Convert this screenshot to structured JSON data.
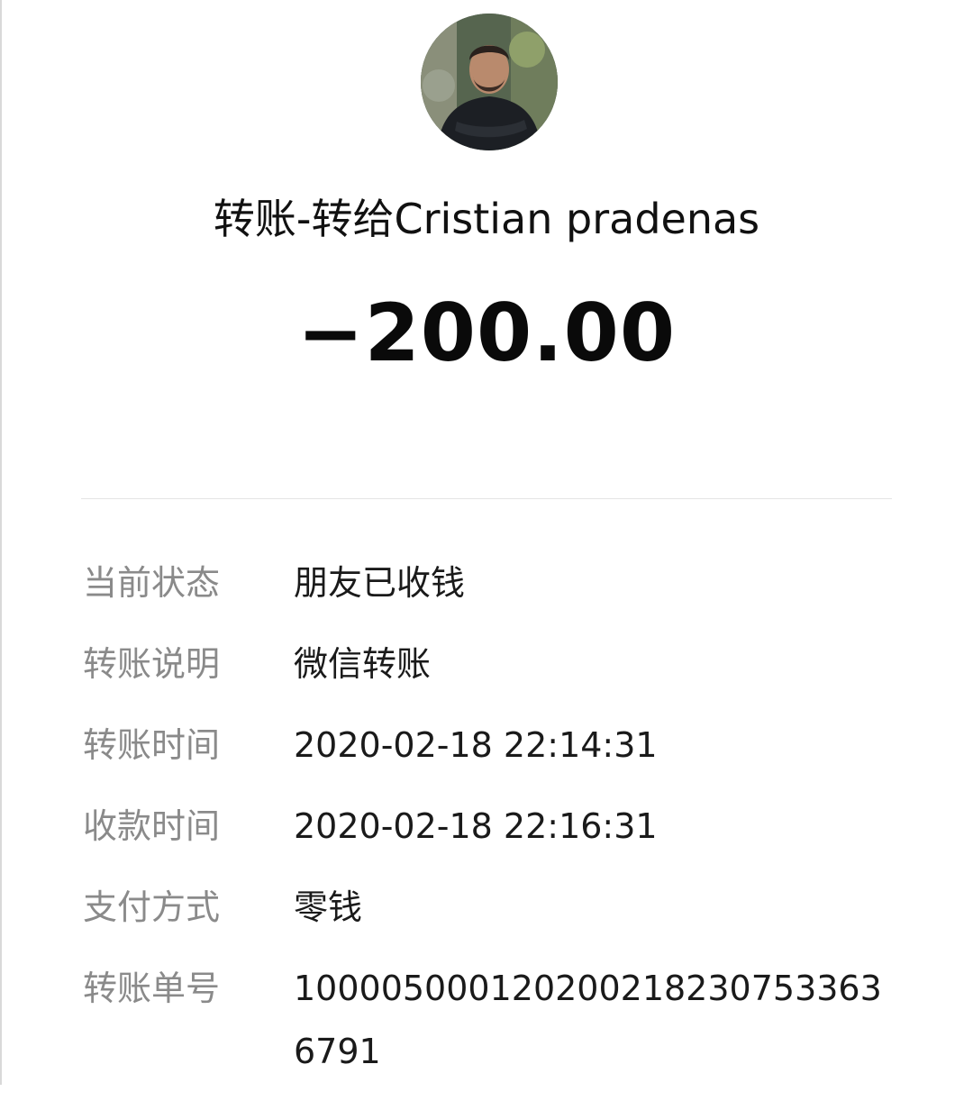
{
  "transfer": {
    "title": "转账-转给Cristian pradenas",
    "amount": "−200.00"
  },
  "details": [
    {
      "label": "当前状态",
      "value": "朋友已收钱"
    },
    {
      "label": "转账说明",
      "value": "微信转账"
    },
    {
      "label": "转账时间",
      "value": "2020-02-18 22:14:31"
    },
    {
      "label": "收款时间",
      "value": "2020-02-18 22:16:31"
    },
    {
      "label": "支付方式",
      "value": "零钱"
    },
    {
      "label": "转账单号",
      "value": "1000050001202002182307533636791"
    }
  ]
}
